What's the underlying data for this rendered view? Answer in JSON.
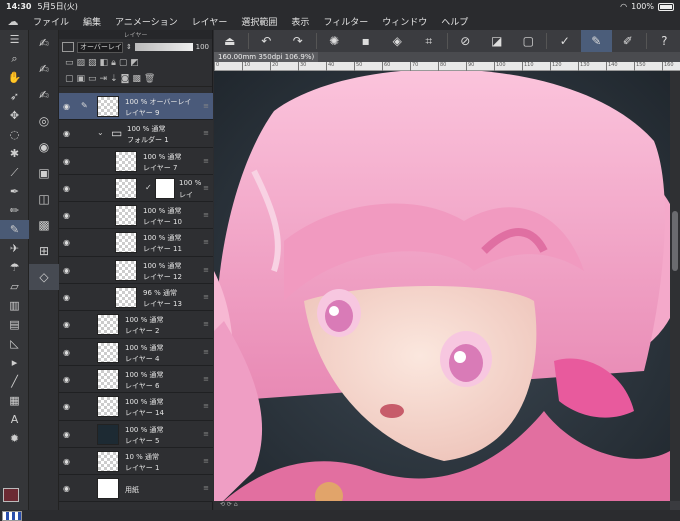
{
  "status": {
    "time": "14:30",
    "date": "5月5日(火)",
    "battery": "100%"
  },
  "menu": {
    "items": [
      "ファイル",
      "編集",
      "アニメーション",
      "レイヤー",
      "選択範囲",
      "表示",
      "フィルター",
      "ウィンドウ",
      "ヘルプ"
    ]
  },
  "layer_panel": {
    "title": "レイヤー",
    "blend_mode": "オーバーレイ",
    "opacity": "100",
    "layers": [
      {
        "line1": "100 % オーバーレイ",
        "line2": "レイヤー 9",
        "level": 0,
        "selected": true,
        "pen": true
      },
      {
        "line1": "100 % 通常",
        "line2": "フォルダー 1",
        "level": 0,
        "folder": true
      },
      {
        "line1": "100 % 通常",
        "line2": "レイヤー 7",
        "level": 1
      },
      {
        "line1": "100 %",
        "line2": "レイ",
        "level": 1,
        "mask": true
      },
      {
        "line1": "100 % 通常",
        "line2": "レイヤー 10",
        "level": 1
      },
      {
        "line1": "100 % 通常",
        "line2": "レイヤー 11",
        "level": 1
      },
      {
        "line1": "100 % 通常",
        "line2": "レイヤー 12",
        "level": 1
      },
      {
        "line1": "96 % 通常",
        "line2": "レイヤー 13",
        "level": 1
      },
      {
        "line1": "100 % 通常",
        "line2": "レイヤー 2",
        "level": 0
      },
      {
        "line1": "100 % 通常",
        "line2": "レイヤー 4",
        "level": 0
      },
      {
        "line1": "100 % 通常",
        "line2": "レイヤー 6",
        "level": 0
      },
      {
        "line1": "100 % 通常",
        "line2": "レイヤー 14",
        "level": 0
      },
      {
        "line1": "100 % 通常",
        "line2": "レイヤー 5",
        "level": 0,
        "dark": true
      },
      {
        "line1": "10 % 通常",
        "line2": "レイヤー 1",
        "level": 0
      },
      {
        "line1": "",
        "line2": "用紙",
        "level": 0,
        "paper": true
      }
    ]
  },
  "canvas": {
    "tab_label": "160.00mm 350dpi 106.9%)",
    "ruler": [
      "0",
      "10",
      "20",
      "30",
      "40",
      "50",
      "60",
      "70",
      "80",
      "90",
      "100",
      "110",
      "120",
      "130",
      "140",
      "150",
      "160"
    ]
  },
  "colors": {
    "accent": "#4a5a7a",
    "main_color": "#6b2a33",
    "hair": "#f4a6c6"
  }
}
